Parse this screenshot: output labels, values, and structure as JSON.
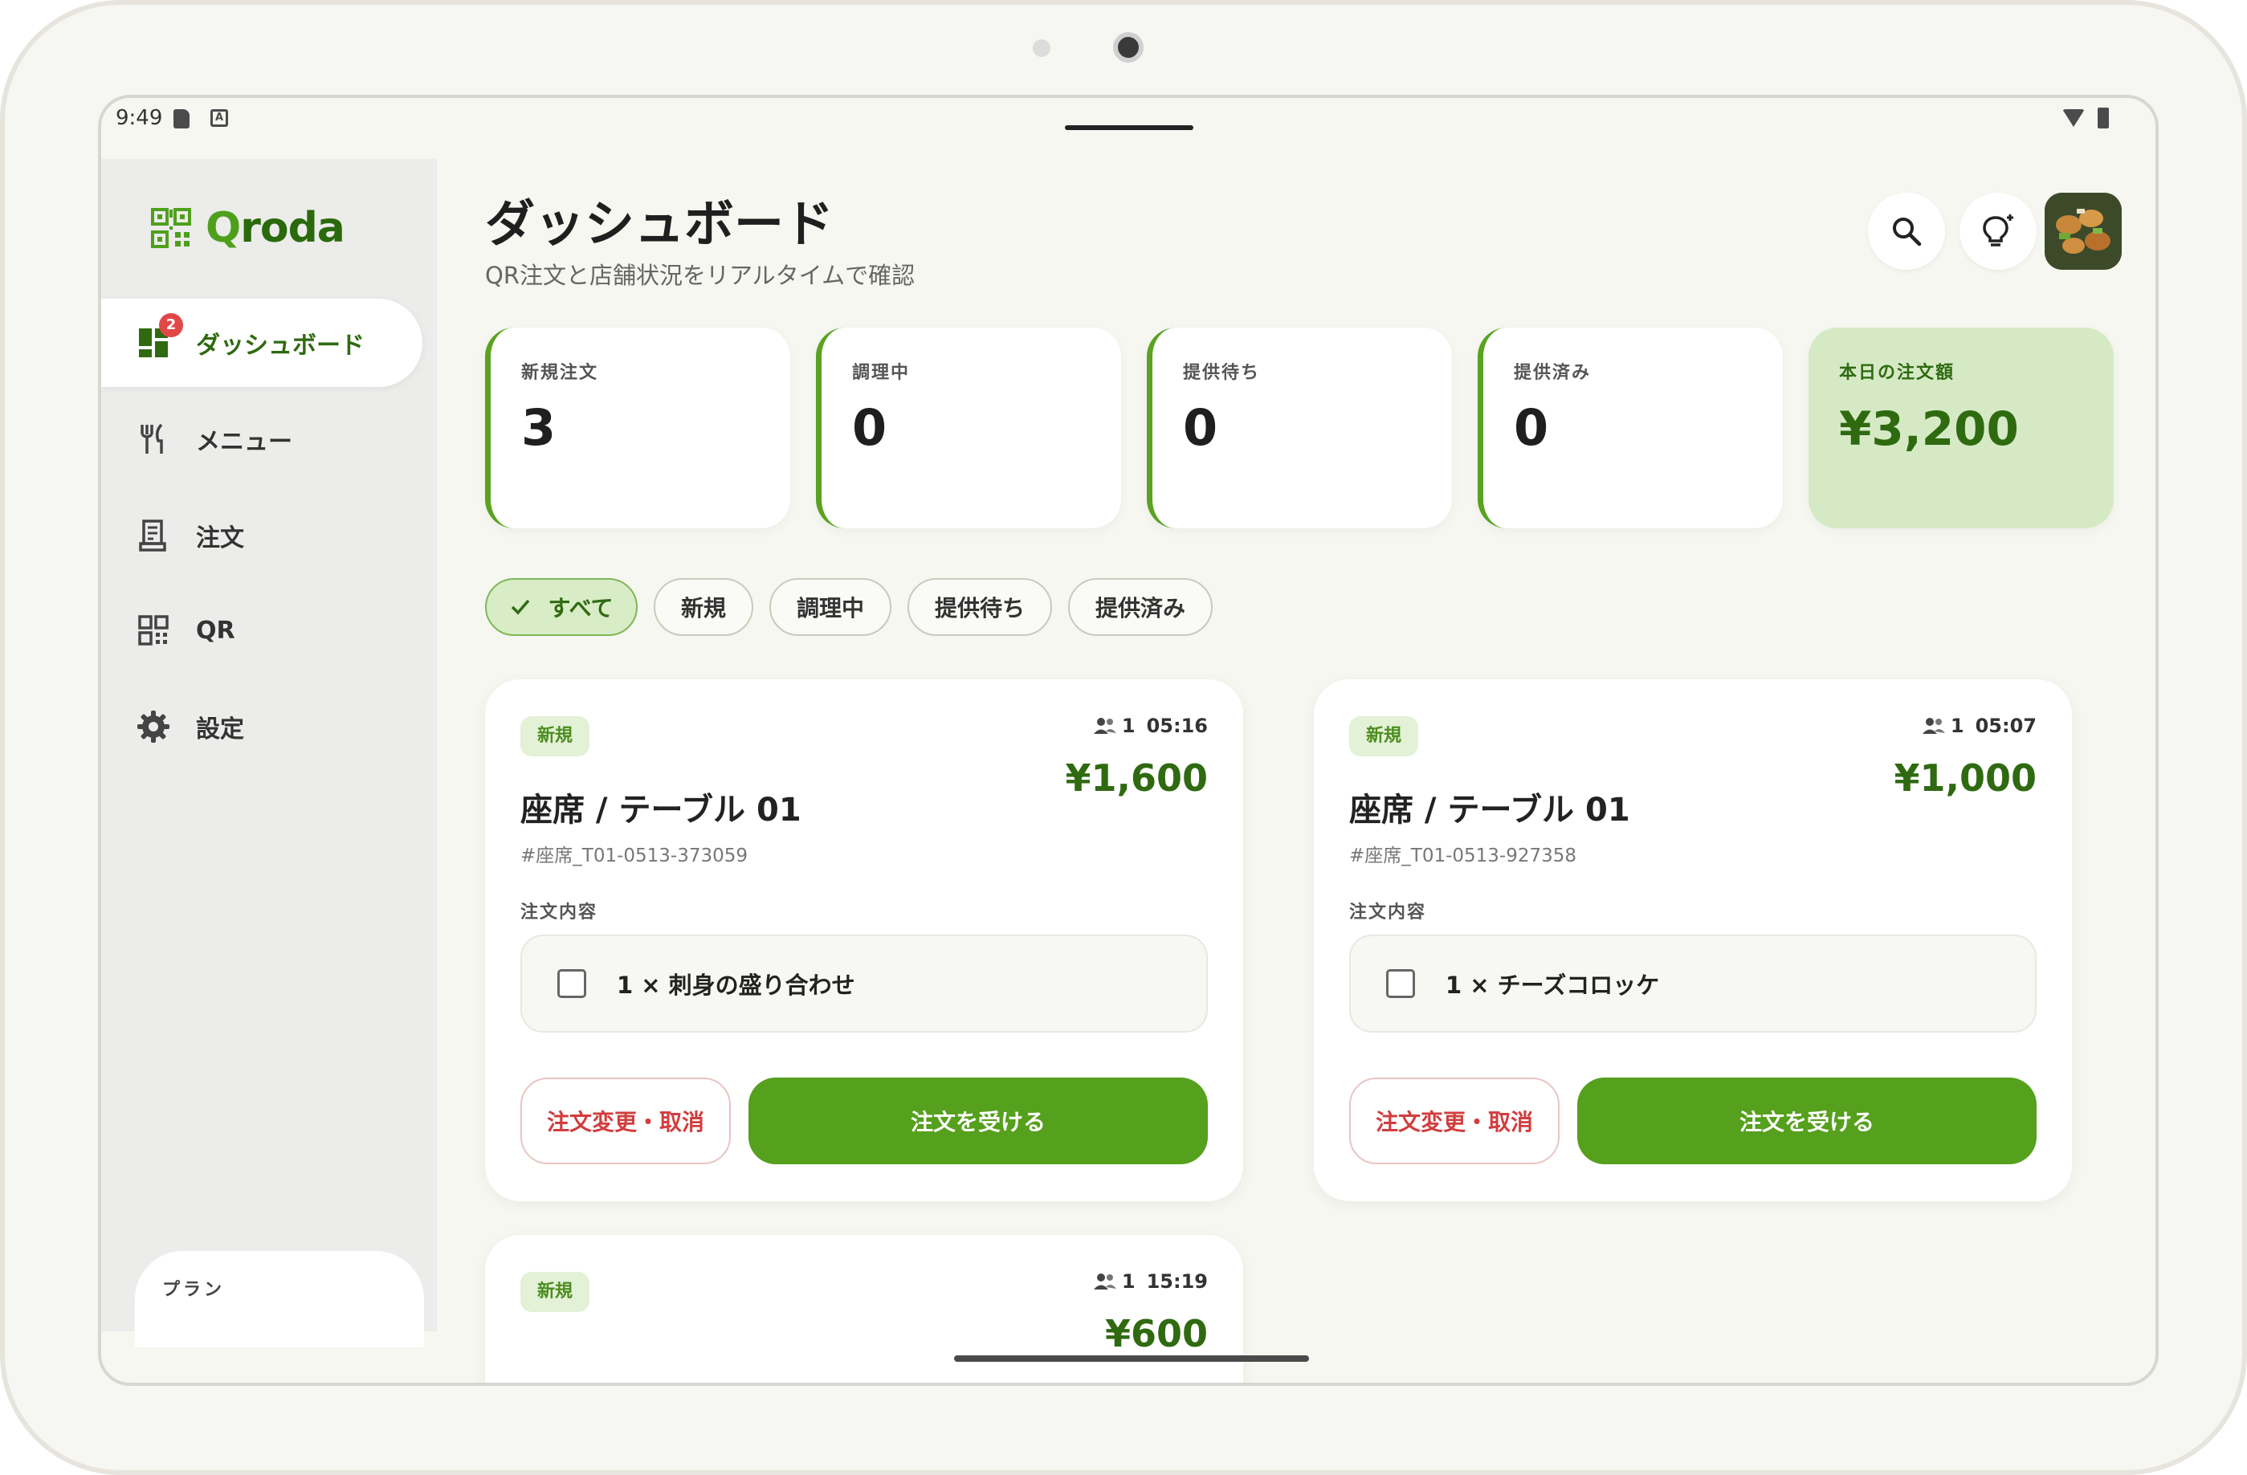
{
  "status_bar": {
    "time": "9:49",
    "a_indicator": "A"
  },
  "app": {
    "name_q": "Q",
    "name_rest": "roda"
  },
  "sidebar": {
    "items": [
      {
        "label": "ダッシュボード",
        "icon": "dashboard-icon",
        "badge": "2",
        "active": true
      },
      {
        "label": "メニュー",
        "icon": "fork-knife-icon"
      },
      {
        "label": "注文",
        "icon": "receipt-icon"
      },
      {
        "label": "QR",
        "icon": "qr-code-icon"
      },
      {
        "label": "設定",
        "icon": "gear-icon"
      }
    ],
    "plan_label": "プラン"
  },
  "header": {
    "title": "ダッシュボード",
    "subtitle": "QR注文と店舗状況をリアルタイムで確認"
  },
  "stats": [
    {
      "label": "新規注文",
      "value": "3"
    },
    {
      "label": "調理中",
      "value": "0"
    },
    {
      "label": "提供待ち",
      "value": "0"
    },
    {
      "label": "提供済み",
      "value": "0"
    },
    {
      "label": "本日の注文額",
      "value": "¥3,200"
    }
  ],
  "filters": [
    {
      "label": "すべて",
      "active": true
    },
    {
      "label": "新規"
    },
    {
      "label": "調理中"
    },
    {
      "label": "提供待ち"
    },
    {
      "label": "提供済み"
    }
  ],
  "orders": [
    {
      "status": "新規",
      "people": "1",
      "time": "05:16",
      "price": "¥1,600",
      "seat": "座席 / テーブル 01",
      "order_id": "#座席_T01-0513-373059",
      "items_label": "注文内容",
      "item": "1 × 刺身の盛り合わせ",
      "cancel_label": "注文変更・取消",
      "accept_label": "注文を受ける"
    },
    {
      "status": "新規",
      "people": "1",
      "time": "05:07",
      "price": "¥1,000",
      "seat": "座席 / テーブル 01",
      "order_id": "#座席_T01-0513-927358",
      "items_label": "注文内容",
      "item": "1 × チーズコロッケ",
      "cancel_label": "注文変更・取消",
      "accept_label": "注文を受ける"
    },
    {
      "status": "新規",
      "people": "1",
      "time": "15:19",
      "price": "¥600"
    }
  ],
  "colors": {
    "brand": "#55a01c",
    "brand_dark": "#2f6a11",
    "danger": "#d23d3d"
  }
}
